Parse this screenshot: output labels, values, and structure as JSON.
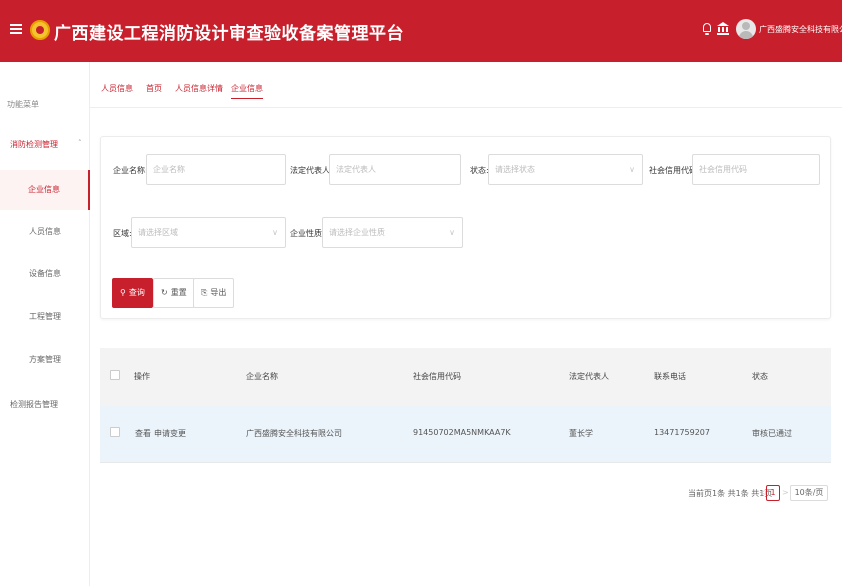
{
  "header": {
    "title": "广西建设工程消防设计审查验收备案管理平台",
    "company": "广西盛腾安全科技有限公司",
    "bg_color": "#c81f2c"
  },
  "sidebar": {
    "menu_title": "功能菜单",
    "group_label": "消防检测管理",
    "group_chevron": "˄",
    "items": [
      {
        "label": "企业信息",
        "active": true
      },
      {
        "label": "人员信息"
      },
      {
        "label": "设备信息"
      },
      {
        "label": "工程管理"
      },
      {
        "label": "方案管理"
      }
    ],
    "group2_label": "检测报告管理"
  },
  "tabs": [
    {
      "label": "人员信息"
    },
    {
      "label": "首页"
    },
    {
      "label": "人员信息详情"
    },
    {
      "label": "企业信息",
      "active": true
    }
  ],
  "filters": {
    "company_name": {
      "label": "企业名称:",
      "placeholder": "企业名称"
    },
    "legal_rep": {
      "label": "法定代表人:",
      "placeholder": "法定代表人"
    },
    "status": {
      "label": "状态:",
      "placeholder": "请选择状态"
    },
    "credit_code": {
      "label": "社会信用代码:",
      "placeholder": "社会信用代码"
    },
    "region": {
      "label": "区域:",
      "placeholder": "请选择区域"
    },
    "company_type": {
      "label": "企业性质:",
      "placeholder": "请选择企业性质"
    }
  },
  "buttons": {
    "search": "查询",
    "reset": "重置",
    "export": "导出",
    "search_icon": "search-icon",
    "reset_icon": "reset-icon",
    "export_icon": "export-icon"
  },
  "table": {
    "columns": [
      "操作",
      "企业名称",
      "社会信用代码",
      "法定代表人",
      "联系电话",
      "状态"
    ],
    "rows": [
      {
        "actions": [
          "查看",
          "申请变更"
        ],
        "company": "广西盛腾安全科技有限公司",
        "credit_code": "91450702MA5NMKAA7K",
        "legal_rep": "董长学",
        "phone": "13471759207",
        "status": "审核已通过"
      }
    ]
  },
  "pager": {
    "info": "当前页1条 共1条 共1页",
    "prev": "<",
    "current_page": "1",
    "next": ">",
    "page_size": "10条/页"
  }
}
